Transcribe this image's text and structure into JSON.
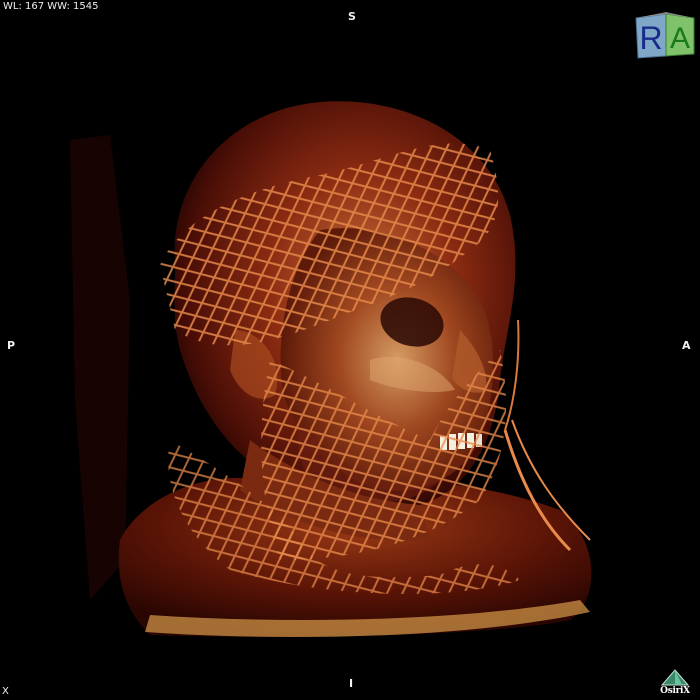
{
  "app": "OsiriX",
  "window_level": "WL: 167 WW: 1545",
  "orientation": {
    "superior": "S",
    "inferior": "I",
    "posterior": "P",
    "anterior": "A"
  },
  "corner_marker": "X",
  "cube": {
    "letter_left": "R",
    "letter_right": "A",
    "face_left_color": "#7fa8c8",
    "face_right_color": "#7fc26a",
    "letter_left_color": "#1a2a8a",
    "letter_right_color": "#1a7a1a"
  },
  "logo": {
    "text": "OsiriX",
    "icon": "osirix-pyramid-icon"
  },
  "render": {
    "description_icon": "volume-render-icon",
    "colors": {
      "background": "#000000",
      "tissue_dark": "#3a0a04",
      "tissue_mid": "#8a2a10",
      "tissue_light": "#c86a3a",
      "net_color": "#e07a40",
      "highlight": "#f0c060"
    }
  }
}
